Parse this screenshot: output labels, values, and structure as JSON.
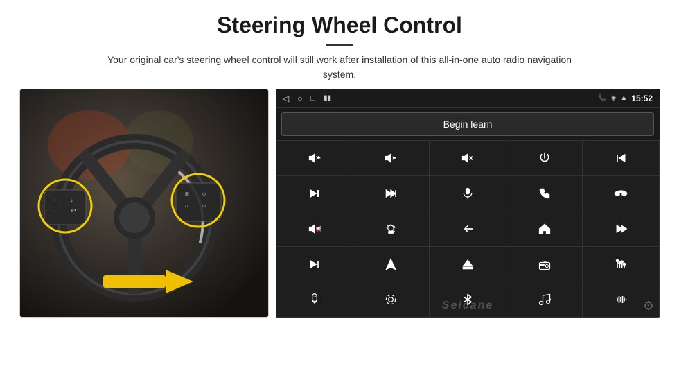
{
  "header": {
    "title": "Steering Wheel Control",
    "divider": true,
    "subtitle": "Your original car's steering wheel control will still work after installation of this all-in-one auto radio navigation system."
  },
  "android_ui": {
    "status_bar": {
      "back_icon": "◁",
      "home_icon": "○",
      "recent_icon": "□",
      "battery_icon": "▮",
      "phone_icon": "📞",
      "location_icon": "◈",
      "wifi_icon": "▲",
      "time": "15:52"
    },
    "begin_learn_label": "Begin learn",
    "controls": [
      {
        "id": "vol-up",
        "icon": "vol+"
      },
      {
        "id": "vol-down",
        "icon": "vol-"
      },
      {
        "id": "mute",
        "icon": "mute"
      },
      {
        "id": "power",
        "icon": "power"
      },
      {
        "id": "prev-track",
        "icon": "prev"
      },
      {
        "id": "skip-forward",
        "icon": "skip-fwd"
      },
      {
        "id": "fast-forward",
        "icon": "ff"
      },
      {
        "id": "mic",
        "icon": "mic"
      },
      {
        "id": "call",
        "icon": "call"
      },
      {
        "id": "end-call",
        "icon": "end"
      },
      {
        "id": "speaker",
        "icon": "speaker"
      },
      {
        "id": "360-cam",
        "icon": "360"
      },
      {
        "id": "back",
        "icon": "back"
      },
      {
        "id": "home",
        "icon": "home"
      },
      {
        "id": "skip-back",
        "icon": "skip-back"
      },
      {
        "id": "next",
        "icon": "next"
      },
      {
        "id": "navigate",
        "icon": "nav"
      },
      {
        "id": "eject",
        "icon": "eject"
      },
      {
        "id": "radio",
        "icon": "radio"
      },
      {
        "id": "equalizer",
        "icon": "eq"
      },
      {
        "id": "mic2",
        "icon": "mic2"
      },
      {
        "id": "settings2",
        "icon": "settings2"
      },
      {
        "id": "bluetooth",
        "icon": "bt"
      },
      {
        "id": "music",
        "icon": "music"
      },
      {
        "id": "waveform",
        "icon": "wave"
      }
    ],
    "watermark": "Seicane",
    "gear_icon": "⚙"
  }
}
